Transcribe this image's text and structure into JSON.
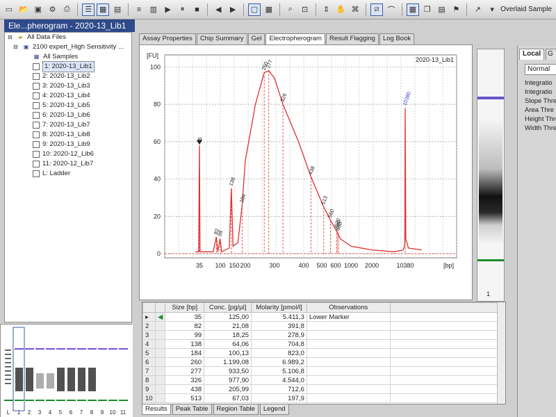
{
  "toolbar": {
    "overlaid_label": "Overlaid Sample"
  },
  "window": {
    "title": "Ele...pherogram - 2020-13_Lib1"
  },
  "tree": {
    "root": "All Data Files",
    "file": "2100 expert_High Sensitivity ...",
    "items": [
      "All Samples",
      "1: 2020-13_Lib1",
      "2: 2020-13_Lib2",
      "3: 2020-13_Lib3",
      "4: 2020-13_Lib4",
      "5: 2020-13_Lib5",
      "6: 2020-13_Lib6",
      "7: 2020-13_Lib7",
      "8: 2020-13_Lib8",
      "9: 2020-13_Lib9",
      "10: 2020-12_Lib6",
      "11: 2020-12_Lib7",
      "L: Ladder"
    ],
    "selected_index": 1
  },
  "thumb_labels": [
    "L",
    "1",
    "2",
    "3",
    "4",
    "5",
    "6",
    "7",
    "8",
    "9",
    "10",
    "11"
  ],
  "tabs": [
    "Assay Properties",
    "Chip Summary",
    "Gel",
    "Electropherogram",
    "Result Flagging",
    "Log Book"
  ],
  "active_tab": "Electropherogram",
  "gel_strip_label": "1",
  "right_panel": {
    "tab_local": "Local",
    "tab_other": "G",
    "mode": "Normal",
    "labels": [
      "Integratio",
      "Integratio",
      "Slope Thre",
      "Area Thre",
      "Height Thre",
      "Width Thre"
    ]
  },
  "chart_data": {
    "type": "line",
    "title": "2020-13_Lib1",
    "ylabel": "[FU]",
    "xlabel": "[bp]",
    "ylim": [
      0,
      105
    ],
    "y_ticks": [
      0,
      20,
      40,
      60,
      80,
      100
    ],
    "x_tick_labels": [
      "35",
      "100",
      "150",
      "200",
      "300",
      "400",
      "500",
      "600",
      "1000",
      "2000",
      "10380"
    ],
    "series": [
      {
        "color": "#e03030",
        "points": [
          {
            "bp": 30,
            "fu": 1
          },
          {
            "bp": 34,
            "fu": 1
          },
          {
            "bp": 35,
            "fu": 58
          },
          {
            "bp": 36,
            "fu": 1
          },
          {
            "bp": 70,
            "fu": 1
          },
          {
            "bp": 82,
            "fu": 9
          },
          {
            "bp": 88,
            "fu": 1
          },
          {
            "bp": 99,
            "fu": 8
          },
          {
            "bp": 104,
            "fu": 1
          },
          {
            "bp": 130,
            "fu": 3
          },
          {
            "bp": 138,
            "fu": 35
          },
          {
            "bp": 145,
            "fu": 4
          },
          {
            "bp": 165,
            "fu": 6
          },
          {
            "bp": 184,
            "fu": 26
          },
          {
            "bp": 200,
            "fu": 50
          },
          {
            "bp": 230,
            "fu": 80
          },
          {
            "bp": 260,
            "fu": 97
          },
          {
            "bp": 277,
            "fu": 98
          },
          {
            "bp": 300,
            "fu": 94
          },
          {
            "bp": 326,
            "fu": 80
          },
          {
            "bp": 380,
            "fu": 60
          },
          {
            "bp": 438,
            "fu": 41
          },
          {
            "bp": 513,
            "fu": 25
          },
          {
            "bp": 560,
            "fu": 18
          },
          {
            "bp": 620,
            "fu": 12
          },
          {
            "bp": 700,
            "fu": 8
          },
          {
            "bp": 1000,
            "fu": 4
          },
          {
            "bp": 2000,
            "fu": 2
          },
          {
            "bp": 6000,
            "fu": 1
          },
          {
            "bp": 9500,
            "fu": 2
          },
          {
            "bp": 10200,
            "fu": 5
          },
          {
            "bp": 10380,
            "fu": 78
          },
          {
            "bp": 10500,
            "fu": 8
          },
          {
            "bp": 11000,
            "fu": 3
          },
          {
            "bp": 14000,
            "fu": 2
          }
        ]
      }
    ],
    "peak_labels": [
      {
        "bp": 35,
        "fu": 58,
        "text": "35"
      },
      {
        "bp": 82,
        "fu": 9,
        "text": "82"
      },
      {
        "bp": 99,
        "fu": 8,
        "text": "99"
      },
      {
        "bp": 138,
        "fu": 35,
        "text": "138"
      },
      {
        "bp": 184,
        "fu": 26,
        "text": "184"
      },
      {
        "bp": 260,
        "fu": 97,
        "text": "260"
      },
      {
        "bp": 277,
        "fu": 98,
        "text": "277"
      },
      {
        "bp": 326,
        "fu": 80,
        "text": "326"
      },
      {
        "bp": 438,
        "fu": 41,
        "text": "438"
      },
      {
        "bp": 513,
        "fu": 25,
        "text": "513"
      },
      {
        "bp": 560,
        "fu": 18,
        "text": "560"
      },
      {
        "bp": 620,
        "fu": 13,
        "text": "620"
      },
      {
        "bp": 640,
        "fu": 12,
        "text": "640"
      },
      {
        "bp": 660,
        "fu": 11,
        "text": "660"
      },
      {
        "bp": 10380,
        "fu": 78,
        "text": "10380"
      }
    ],
    "grid": true
  },
  "results_table": {
    "columns": [
      "Size [bp]",
      "Conc. [pg/µl]",
      "Molarity [pmol/l]",
      "Observations"
    ],
    "rows": [
      {
        "n": "1",
        "size": "35",
        "conc": "125,00",
        "mol": "5.411,3",
        "obs": "Lower Marker"
      },
      {
        "n": "2",
        "size": "82",
        "conc": "21,08",
        "mol": "391,8",
        "obs": ""
      },
      {
        "n": "3",
        "size": "99",
        "conc": "18,25",
        "mol": "278,9",
        "obs": ""
      },
      {
        "n": "4",
        "size": "138",
        "conc": "64,06",
        "mol": "704,8",
        "obs": ""
      },
      {
        "n": "5",
        "size": "184",
        "conc": "100,13",
        "mol": "823,0",
        "obs": ""
      },
      {
        "n": "6",
        "size": "260",
        "conc": "1.199,08",
        "mol": "6.989,2",
        "obs": ""
      },
      {
        "n": "7",
        "size": "277",
        "conc": "933,50",
        "mol": "5.106,8",
        "obs": ""
      },
      {
        "n": "8",
        "size": "326",
        "conc": "977,90",
        "mol": "4.544,0",
        "obs": ""
      },
      {
        "n": "9",
        "size": "438",
        "conc": "205,99",
        "mol": "712,6",
        "obs": ""
      },
      {
        "n": "10",
        "size": "513",
        "conc": "67,03",
        "mol": "197,9",
        "obs": ""
      }
    ]
  },
  "bottom_tabs": [
    "Results",
    "Peak Table",
    "Region Table",
    "Legend"
  ],
  "colors": {
    "trace": "#e03030",
    "marker_purple": "#7a4fd6",
    "marker_green": "#1a8a2a",
    "title_bar": "#2f4a8a"
  }
}
